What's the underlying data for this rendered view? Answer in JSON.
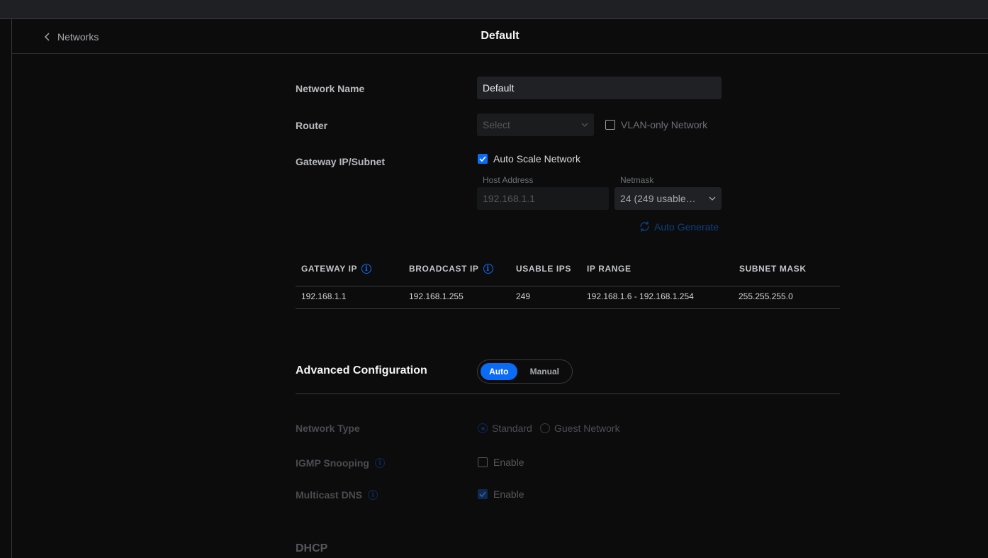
{
  "header": {
    "back_label": "Networks",
    "title": "Default"
  },
  "form": {
    "network_name_label": "Network Name",
    "network_name_value": "Default",
    "router_label": "Router",
    "router_placeholder": "Select",
    "vlan_only_label": "VLAN-only Network",
    "vlan_only_checked": false,
    "gateway_label": "Gateway IP/Subnet",
    "auto_scale_label": "Auto Scale Network",
    "auto_scale_checked": true,
    "host_address_label": "Host Address",
    "host_address_value": "192.168.1.1",
    "netmask_label": "Netmask",
    "netmask_value": "24 (249 usable…",
    "auto_generate_label": "Auto Generate"
  },
  "summary_table": {
    "headers": [
      "GATEWAY IP",
      "BROADCAST IP",
      "USABLE IPS",
      "IP RANGE",
      "SUBNET MASK"
    ],
    "row": [
      "192.168.1.1",
      "192.168.1.255",
      "249",
      "192.168.1.6 - 192.168.1.254",
      "255.255.255.0"
    ]
  },
  "advanced": {
    "title": "Advanced Configuration",
    "mode_options": [
      "Auto",
      "Manual"
    ],
    "mode_selected": "Auto",
    "network_type_label": "Network Type",
    "network_type_options": [
      "Standard",
      "Guest Network"
    ],
    "network_type_selected": "Standard",
    "igmp_label": "IGMP Snooping",
    "igmp_option_label": "Enable",
    "igmp_checked": false,
    "mdns_label": "Multicast DNS",
    "mdns_option_label": "Enable",
    "mdns_checked": true
  },
  "dhcp": {
    "title": "DHCP"
  },
  "colors": {
    "accent": "#0a6cf5",
    "background": "#0c0c0d",
    "input_bg": "#202124"
  }
}
